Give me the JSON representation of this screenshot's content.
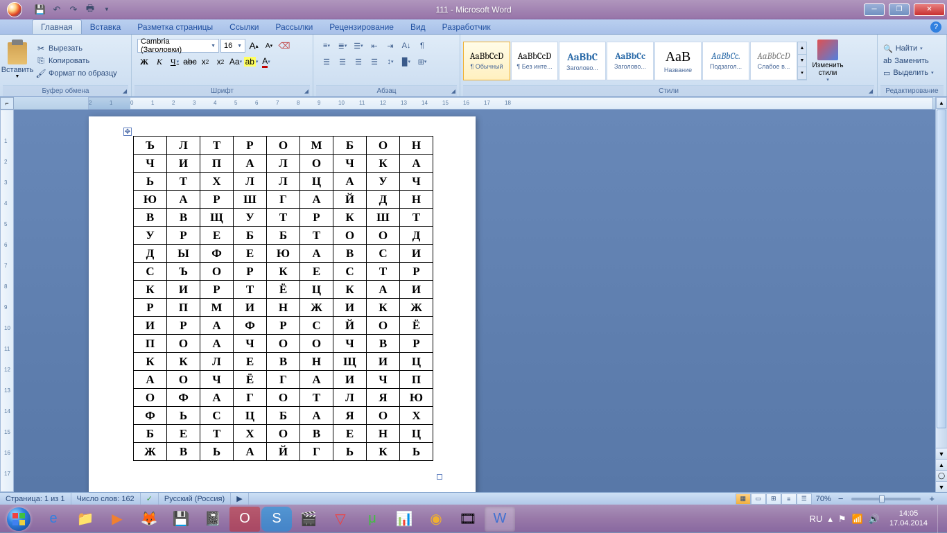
{
  "title": "111 - Microsoft Word",
  "tabs": [
    "Главная",
    "Вставка",
    "Разметка страницы",
    "Ссылки",
    "Рассылки",
    "Рецензирование",
    "Вид",
    "Разработчик"
  ],
  "active_tab": 0,
  "clipboard": {
    "paste": "Вставить",
    "cut": "Вырезать",
    "copy": "Копировать",
    "format": "Формат по образцу",
    "label": "Буфер обмена"
  },
  "font": {
    "name": "Cambria (Заголовки)",
    "size": "16",
    "label": "Шрифт"
  },
  "paragraph": {
    "label": "Абзац"
  },
  "styles": {
    "label": "Стили",
    "change": "Изменить стили",
    "items": [
      {
        "preview": "AaBbCcD",
        "name": "¶ Обычный",
        "color": "#000",
        "selected": true
      },
      {
        "preview": "AaBbCcD",
        "name": "¶ Без инте...",
        "color": "#000"
      },
      {
        "preview": "AaBbC",
        "name": "Заголово...",
        "color": "#2a6aa8",
        "bold": true,
        "big": true
      },
      {
        "preview": "AaBbCc",
        "name": "Заголово...",
        "color": "#2a6aa8",
        "bold": true
      },
      {
        "preview": "АаВ",
        "name": "Название",
        "color": "#000",
        "bigger": true
      },
      {
        "preview": "AaBbCc.",
        "name": "Подзагол...",
        "color": "#2a6aa8",
        "italic": true
      },
      {
        "preview": "AaBbCcD",
        "name": "Слабое в...",
        "color": "#808080",
        "italic": true
      }
    ]
  },
  "editing": {
    "find": "Найти",
    "replace": "Заменить",
    "select": "Выделить",
    "label": "Редактирование"
  },
  "status": {
    "page": "Страница: 1 из 1",
    "words": "Число слов: 162",
    "lang": "Русский (Россия)",
    "zoom": "70%"
  },
  "tray": {
    "lang": "RU",
    "time": "14:05",
    "date": "17.04.2014"
  },
  "table": [
    [
      "Ъ",
      "Л",
      "Т",
      "Р",
      "О",
      "М",
      "Б",
      "О",
      "Н"
    ],
    [
      "Ч",
      "И",
      "П",
      "А",
      "Л",
      "О",
      "Ч",
      "К",
      "А"
    ],
    [
      "Ь",
      "Т",
      "Х",
      "Л",
      "Л",
      "Ц",
      "А",
      "У",
      "Ч"
    ],
    [
      "Ю",
      "А",
      "Р",
      "Ш",
      "Г",
      "А",
      "Й",
      "Д",
      "Н"
    ],
    [
      "В",
      "В",
      "Щ",
      "У",
      "Т",
      "Р",
      "К",
      "Ш",
      "Т"
    ],
    [
      "У",
      "Р",
      "Е",
      "Б",
      "Б",
      "Т",
      "О",
      "О",
      "Д"
    ],
    [
      "Д",
      "Ы",
      "Ф",
      "Е",
      "Ю",
      "А",
      "В",
      "С",
      "И"
    ],
    [
      "С",
      "Ъ",
      "О",
      "Р",
      "К",
      "Е",
      "С",
      "Т",
      "Р"
    ],
    [
      "К",
      "И",
      "Р",
      "Т",
      "Ё",
      "Ц",
      "К",
      "А",
      "И"
    ],
    [
      "Р",
      "П",
      "М",
      "И",
      "Н",
      "Ж",
      "И",
      "К",
      "Ж"
    ],
    [
      "И",
      "Р",
      "А",
      "Ф",
      "Р",
      "С",
      "Й",
      "О",
      "Ё"
    ],
    [
      "П",
      "О",
      "А",
      "Ч",
      "О",
      "О",
      "Ч",
      "В",
      "Р"
    ],
    [
      "К",
      "К",
      "Л",
      "Е",
      "В",
      "Н",
      "Щ",
      "И",
      "Ц"
    ],
    [
      "А",
      "О",
      "Ч",
      "Ё",
      "Г",
      "А",
      "И",
      "Ч",
      "П"
    ],
    [
      "О",
      "Ф",
      "А",
      "Г",
      "О",
      "Т",
      "Л",
      "Я",
      "Ю"
    ],
    [
      "Ф",
      "Ь",
      "С",
      "Ц",
      "Б",
      "А",
      "Я",
      "О",
      "Х"
    ],
    [
      "Б",
      "Е",
      "Т",
      "Х",
      "О",
      "В",
      "Е",
      "Н",
      "Ц"
    ],
    [
      "Ж",
      "В",
      "Ь",
      "А",
      "Й",
      "Г",
      "Ь",
      "К",
      "Ь"
    ]
  ]
}
